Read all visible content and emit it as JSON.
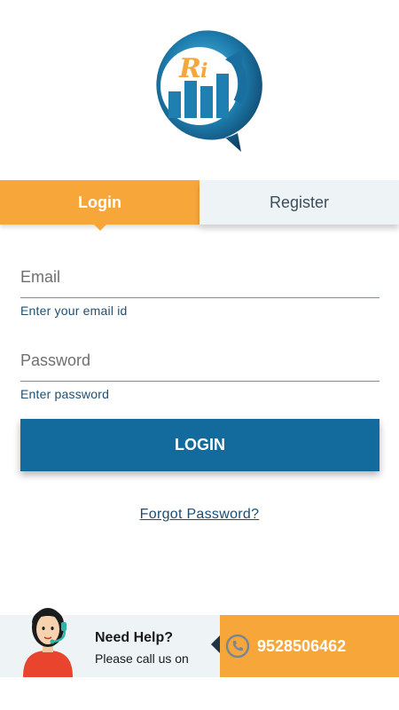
{
  "brand": {
    "logo_letters": "Ri",
    "primary_color": "#126b9c",
    "accent_color": "#f7a63a"
  },
  "tabs": {
    "login_label": "Login",
    "register_label": "Register",
    "active": "login"
  },
  "form": {
    "email_placeholder": "Email",
    "email_hint": "Enter your email id",
    "password_placeholder": "Password",
    "password_hint": "Enter password",
    "submit_label": "LOGIN",
    "forgot_label": "Forgot Password?"
  },
  "help": {
    "title": "Need Help?",
    "subtitle": "Please call us on",
    "phone": "9528506462",
    "icons": {
      "agent": "support-agent-icon",
      "phone": "phone-icon"
    }
  }
}
